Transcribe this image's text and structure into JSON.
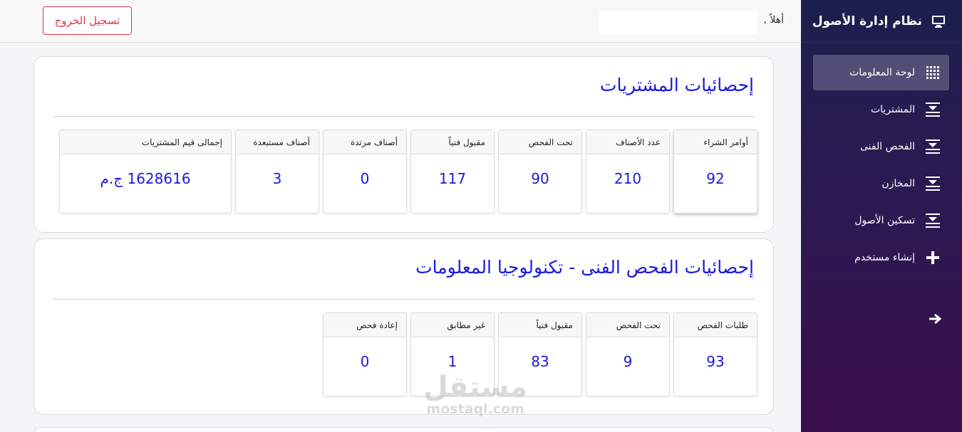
{
  "app": {
    "title": "نظام إدارة الأصول"
  },
  "sidebar": {
    "items": [
      {
        "label": "لوحة المعلومات",
        "icon": "grid-icon",
        "active": true
      },
      {
        "label": "المشتريات",
        "icon": "collapse-arrows-icon"
      },
      {
        "label": "الفحص الفنى",
        "icon": "collapse-arrows-icon"
      },
      {
        "label": "المخازن",
        "icon": "collapse-arrows-icon"
      },
      {
        "label": "تسكين الأصول",
        "icon": "collapse-arrows-icon"
      },
      {
        "label": "إنشاء مستخدم",
        "icon": "plus-icon"
      }
    ]
  },
  "topbar": {
    "greeting": "أهلاً ,",
    "logout_label": "تسجيل الخروج"
  },
  "purchases": {
    "title": "إحصائيات المشتريات",
    "stats": [
      {
        "label": "أوامر الشراء",
        "value": "92"
      },
      {
        "label": "عدد الأصناف",
        "value": "210"
      },
      {
        "label": "تحت الفحص",
        "value": "90"
      },
      {
        "label": "مقبول فنياً",
        "value": "117"
      },
      {
        "label": "أصناف مرتدة",
        "value": "0"
      },
      {
        "label": "أصناف مستبعدة",
        "value": "3"
      },
      {
        "label": "إجمالى قيم المشتريات",
        "value": "1628616 ج.م"
      }
    ]
  },
  "inspection": {
    "title": "إحصائيات الفحص الفنى - تكنولوجيا المعلومات",
    "stats": [
      {
        "label": "طلبات الفحص",
        "value": "93"
      },
      {
        "label": "تحت الفحص",
        "value": "9"
      },
      {
        "label": "مقبول فنياً",
        "value": "83"
      },
      {
        "label": "غير مطابق",
        "value": "1"
      },
      {
        "label": "إعادة فحص",
        "value": "0"
      }
    ]
  },
  "watermark": {
    "arabic": "مستقل",
    "latin": "mostaql.com"
  },
  "colors": {
    "accent": "#1a1adc",
    "danger": "#dc3545",
    "sidebar_top": "#1c1f4e",
    "sidebar_bottom": "#3a0d4b"
  }
}
